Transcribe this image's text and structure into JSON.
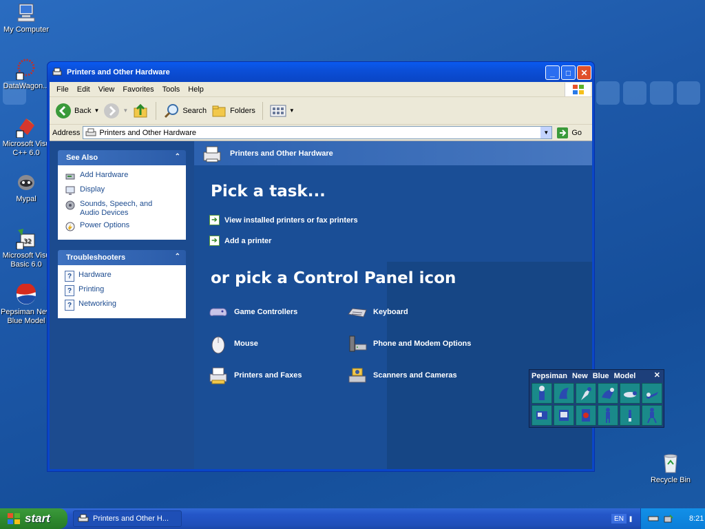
{
  "desktop": {
    "icons": [
      {
        "label": "My Computer",
        "icon": "my-computer-icon"
      },
      {
        "label": "DataWagon...",
        "icon": "datawagon-icon"
      },
      {
        "label": "Microsoft Visu C++ 6.0",
        "icon": "visual-cpp-icon"
      },
      {
        "label": "Mypal",
        "icon": "mypal-icon"
      },
      {
        "label": "Microsoft Visu Basic 6.0",
        "icon": "visual-basic-icon"
      },
      {
        "label": "Pepsiman New Blue Model",
        "icon": "pepsiman-icon"
      },
      {
        "label": "Recycle Bin",
        "icon": "recycle-bin-icon"
      }
    ]
  },
  "window": {
    "title": "Printers and Other Hardware",
    "menu": [
      "File",
      "Edit",
      "View",
      "Favorites",
      "Tools",
      "Help"
    ],
    "toolbar": {
      "back": "Back",
      "search": "Search",
      "folders": "Folders"
    },
    "address": {
      "label": "Address",
      "value": "Printers and Other Hardware",
      "go": "Go"
    },
    "see_also": {
      "title": "See Also",
      "items": [
        "Add Hardware",
        "Display",
        "Sounds, Speech, and Audio Devices",
        "Power Options"
      ]
    },
    "troubleshooters": {
      "title": "Troubleshooters",
      "items": [
        "Hardware",
        "Printing",
        "Networking"
      ]
    },
    "main": {
      "header": "Printers and Other Hardware",
      "pick_task": "Pick a task...",
      "tasks": [
        "View installed printers or fax printers",
        "Add a printer"
      ],
      "pick_icon": "or pick a Control Panel icon",
      "icons": [
        "Game Controllers",
        "Keyboard",
        "Mouse",
        "Phone and Modem Options",
        "Printers and Faxes",
        "Scanners and Cameras"
      ]
    }
  },
  "pepsiman_window": {
    "title": "Pepsiman New Blue Model",
    "close": "✕"
  },
  "taskbar": {
    "start": "start",
    "task_item": "Printers and Other H...",
    "language": "EN",
    "clock": "8:21"
  },
  "colors": {
    "window_blue": "#0a46c8",
    "pane_blue": "#1c4b8f",
    "start_green": "#2f8a2f"
  }
}
